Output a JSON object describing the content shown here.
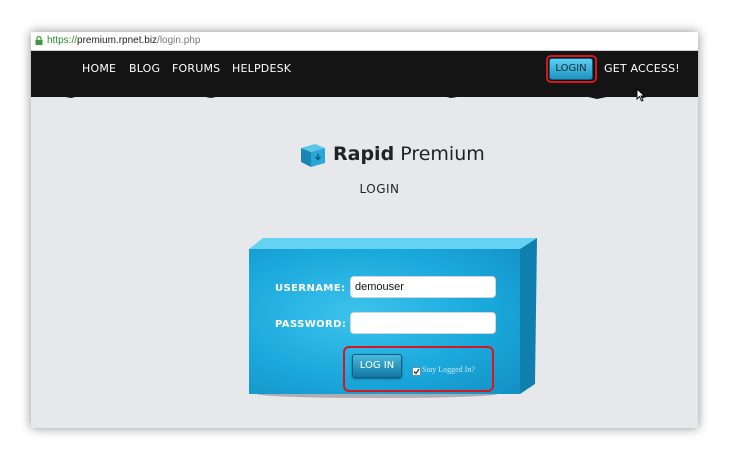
{
  "browser": {
    "url_scheme": "https://",
    "url_domain": "premium.rpnet.biz",
    "url_path": "/login.php"
  },
  "nav": {
    "items": [
      "HOME",
      "BLOG",
      "FORUMS",
      "HELPDESK"
    ],
    "login_label": "LOGIN",
    "access_label": "GET ACCESS!"
  },
  "logo": {
    "brand_bold": "Rapid",
    "brand_light": "Premium"
  },
  "page": {
    "heading": "LOGIN"
  },
  "form": {
    "username_label": "USERNAME:",
    "username_value": "demouser",
    "password_label": "PASSWORD:",
    "password_value": "",
    "submit_label": "LOG IN",
    "stay_logged_label": "Stay Logged In?",
    "stay_logged_checked": true
  },
  "colors": {
    "nav_bg": "#141414",
    "form_blue": "#1aa9dc",
    "highlight_red": "#d8161d",
    "page_bg": "#e7e8ec"
  }
}
